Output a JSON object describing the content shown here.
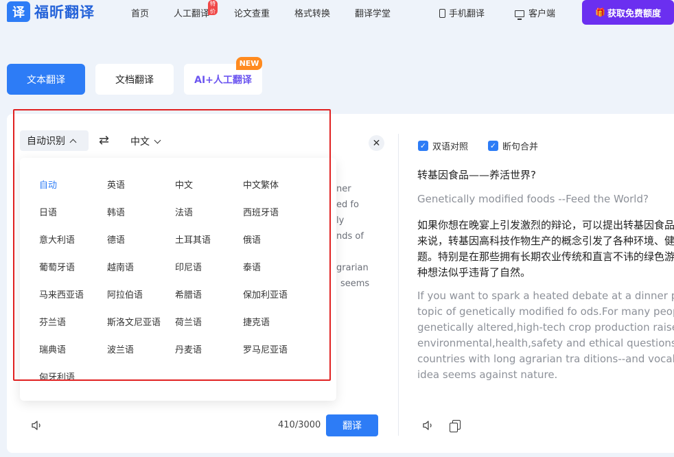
{
  "header": {
    "logo_mark": "译",
    "logo_text": "福昕翻译",
    "nav": [
      "首页",
      "人工翻译",
      "论文查重",
      "格式转换",
      "翻译学堂"
    ],
    "nav_badge": "特价",
    "mobile": "手机翻译",
    "client": "客户端",
    "cta": "获取免费额度",
    "cta_icon": "gift-icon"
  },
  "modes": {
    "text": "文本翻译",
    "doc": "文档翻译",
    "ai": "AI+人工翻译",
    "new_badge": "NEW"
  },
  "lang_bar": {
    "source": "自动识别",
    "target": "中文",
    "swap_icon": "swap-icon"
  },
  "dropdown": {
    "options": [
      "自动",
      "英语",
      "中文",
      "中文繁体",
      "日语",
      "韩语",
      "法语",
      "西班牙语",
      "意大利语",
      "德语",
      "土耳其语",
      "俄语",
      "葡萄牙语",
      "越南语",
      "印尼语",
      "泰语",
      "马来西亚语",
      "阿拉伯语",
      "希腊语",
      "保加利亚语",
      "芬兰语",
      "斯洛文尼亚语",
      "荷兰语",
      "捷克语",
      "瑞典语",
      "波兰语",
      "丹麦语",
      "罗马尼亚语",
      "匈牙利语"
    ],
    "selected": "自动"
  },
  "source_fragments": [
    "ner",
    "ed fo",
    "ly",
    "nds of",
    "grarian",
    "seems"
  ],
  "footer": {
    "counter": "410/3000",
    "translate": "翻译"
  },
  "result": {
    "bilingual": "双语对照",
    "merge": "断句合并",
    "zh_title": "转基因食品——养活世界?",
    "en_title": "Genetically modified foods --Feed the World?",
    "zh_para": [
      "如果你想在晚宴上引发激烈的辩论，可以提出转基因食品",
      "来说，转基因高科技作物生产的概念引发了各种环境、健",
      "题。特别是在那些拥有长期农业传统和直言不讳的绿色游",
      "种想法似乎违背了自然。"
    ],
    "en_para": [
      "If you want to spark a heated debate at a dinner pa",
      "topic of genetically modified fo ods.For many peop",
      "genetically altered,high-tech crop production raises",
      "environmental,health,safety and ethical questions.P",
      "countries with long agrarian tra ditions--and vocal g",
      "idea seems against nature."
    ]
  },
  "colors": {
    "primary": "#2d7cf6",
    "cta": "#6b2ff0",
    "highlight": "#e02020",
    "new_badge": "#ff8a1f"
  }
}
